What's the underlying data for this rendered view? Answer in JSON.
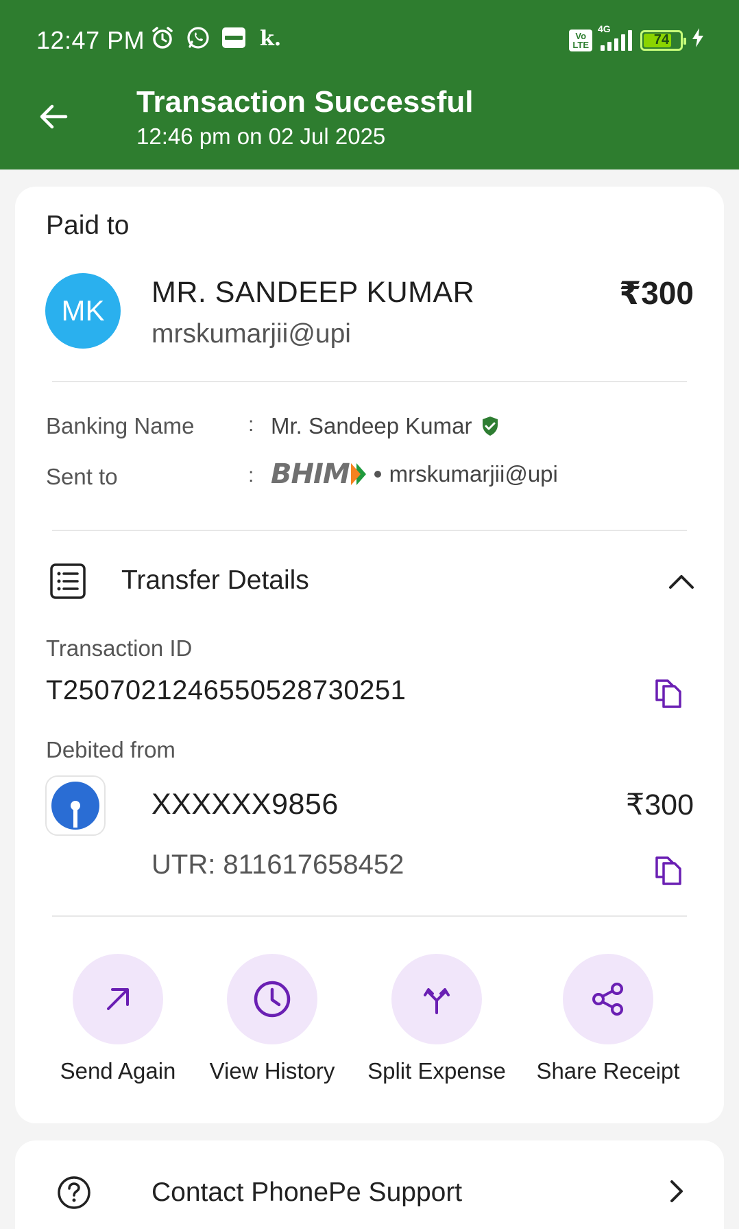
{
  "status_bar": {
    "time": "12:47 PM",
    "network": "4G",
    "volte": "Vo LTE",
    "battery_percent": "74",
    "icons": [
      "alarm-icon",
      "whatsapp-icon",
      "paytm-icon",
      "k-app-icon",
      "charging-icon"
    ]
  },
  "header": {
    "title": "Transaction Successful",
    "subtitle": "12:46 pm on 02 Jul 2025",
    "bg_color": "#2e7d2f"
  },
  "payee": {
    "section_label": "Paid to",
    "initials": "MK",
    "name": "MR. SANDEEP  KUMAR",
    "upi_id": "mrskumarjii@upi",
    "amount": "₹300"
  },
  "details": {
    "banking_name_label": "Banking Name",
    "banking_name_value": "Mr. Sandeep  Kumar",
    "sent_to_label": "Sent to",
    "sent_to_app": "BHIM",
    "sent_to_upi": "mrskumarjii@upi",
    "colon": ":"
  },
  "transfer": {
    "title": "Transfer Details",
    "transaction_id_label": "Transaction ID",
    "transaction_id": "T2507021246550528730251",
    "debited_from_label": "Debited from",
    "account": "XXXXXX9856",
    "debited_amount": "₹300",
    "utr": "UTR: 811617658452"
  },
  "actions": [
    {
      "label": "Send Again",
      "icon": "arrow-up-right-icon"
    },
    {
      "label": "View History",
      "icon": "clock-icon"
    },
    {
      "label": "Split Expense",
      "icon": "split-icon"
    },
    {
      "label": "Share Receipt",
      "icon": "share-icon"
    }
  ],
  "support": {
    "label": "Contact PhonePe Support",
    "icon": "help-icon"
  },
  "colors": {
    "accent_purple": "#6a1fb3",
    "action_bg": "#f1e6fa",
    "avatar_bg": "#2ab0ee",
    "verified_green": "#2e7d32"
  }
}
